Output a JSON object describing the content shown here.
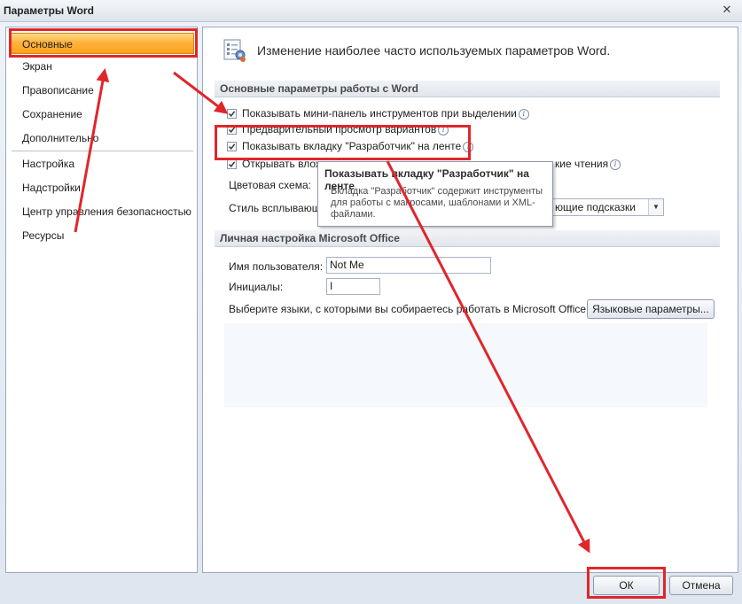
{
  "window": {
    "title": "Параметры Word",
    "close_glyph": "✕"
  },
  "sidebar": {
    "items": [
      {
        "label": "Основные",
        "selected": true
      },
      {
        "label": "Экран"
      },
      {
        "label": "Правописание"
      },
      {
        "label": "Сохранение"
      },
      {
        "label": "Дополнительно"
      },
      {
        "label": "Настройка"
      },
      {
        "label": "Надстройки"
      },
      {
        "label": "Центр управления безопасностью"
      },
      {
        "label": "Ресурсы"
      }
    ]
  },
  "main": {
    "header": "Изменение наиболее часто используемых параметров Word.",
    "section1": {
      "title": "Основные параметры работы с Word",
      "options": [
        {
          "label": "Показывать мини-панель инструментов при выделении",
          "checked": true
        },
        {
          "label": "Предварительный просмотр вариантов",
          "checked": true
        },
        {
          "label": "Показывать вкладку \"Разработчик\" на ленте",
          "checked": true
        },
        {
          "label": "Открывать влож",
          "label_tail": "кие чтения",
          "checked": true
        }
      ],
      "color_scheme_label": "Цветовая схема:",
      "tooltip_style_label": "Стиль всплывающи",
      "tooltip_style_value": "ющие подсказки"
    },
    "section2": {
      "title": "Личная настройка Microsoft Office",
      "username_label": "Имя пользователя:",
      "username_value": "Not Me",
      "initials_label": "Инициалы:",
      "initials_value": "I",
      "languages_text": "Выберите языки, с которыми вы собираетесь работать в Microsoft Office:",
      "languages_button": "Языковые параметры..."
    }
  },
  "tooltip": {
    "title": "Показывать вкладку \"Разработчик\" на ленте",
    "body": "Вкладка \"Разработчик\" содержит инструменты для работы с макросами, шаблонами и XML-файлами."
  },
  "footer": {
    "ok_label": "ОК",
    "cancel_label": "Отмена"
  },
  "colors": {
    "highlight": "#e0262b",
    "selection": "#ffb33c"
  }
}
